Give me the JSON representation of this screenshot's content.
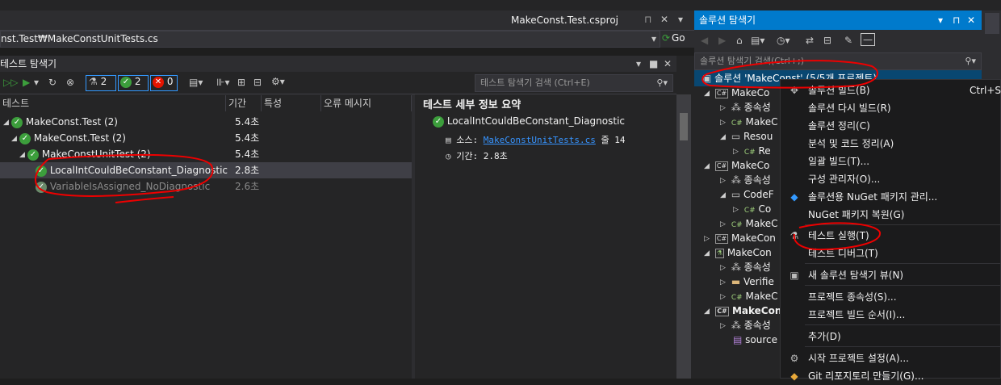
{
  "editor": {
    "doc_tab_title": "MakeConst.Test.csproj",
    "doc_tab_close": "✕",
    "nav_path": "nst.Test₩MakeConstUnitTests.cs",
    "go_label": "Go"
  },
  "test_explorer": {
    "title": "테스트 탐색기",
    "counts": {
      "total": "2",
      "passed": "2",
      "failed": "0"
    },
    "search_placeholder": "테스트 탐색기 검색 (Ctrl+E)",
    "columns": [
      "테스트",
      "기간",
      "특성",
      "오류 메시지"
    ],
    "rows": [
      {
        "name": "MakeConst.Test (2)",
        "duration": "5.4초"
      },
      {
        "name": "MakeConst.Test (2)",
        "duration": "5.4초"
      },
      {
        "name": "MakeConstUnitTest (2)",
        "duration": "5.4초"
      },
      {
        "name": "LocalIntCouldBeConstant_Diagnostic",
        "duration": "2.8초"
      },
      {
        "name": "VariableIsAssigned_NoDiagnostic",
        "duration": "2.6초"
      }
    ],
    "detail": {
      "title": "테스트 세부 정보 요약",
      "test_name": "LocalIntCouldBeConstant_Diagnostic",
      "source_label": "소스:",
      "source_file": "MakeConstUnitTests.cs",
      "line_label": "줄",
      "line_number": "14",
      "duration_label": "기간:",
      "duration_value": "2.8초"
    }
  },
  "solution_explorer": {
    "title": "솔루션 탐색기",
    "search_placeholder": "솔루션 탐색기 검색(Ctrl+;)",
    "solution_label": "솔루션 'MakeConst' (5/5개 프로젝트)",
    "tree": [
      "MakeCo",
      "종속성",
      "MakeC",
      "Resou",
      "Re",
      "MakeCo",
      "종속성",
      "CodeF",
      "Co",
      "MakeC",
      "MakeCon",
      "MakeCon",
      "종속성",
      "Verifie",
      "MakeC",
      "MakeCons",
      "종속성",
      "source"
    ]
  },
  "context_menu": {
    "items": [
      {
        "label": "솔루션 빌드(B)",
        "shortcut": "Ctrl+Sh"
      },
      {
        "label": "솔루션 다시 빌드(R)"
      },
      {
        "label": "솔루션 정리(C)"
      },
      {
        "label": "분석 및 코드 정리(A)"
      },
      {
        "label": "일괄 빌드(T)..."
      },
      {
        "label": "구성 관리자(O)..."
      },
      {
        "label": "솔루션용 NuGet 패키지 관리..."
      },
      {
        "label": "NuGet 패키지 복원(G)"
      },
      {
        "label": "테스트 실행(T)"
      },
      {
        "label": "테스트 디버그(T)"
      },
      {
        "label": "새 솔루션 탐색기 뷰(N)"
      },
      {
        "label": "프로젝트 종속성(S)..."
      },
      {
        "label": "프로젝트 빌드 순서(I)..."
      },
      {
        "label": "추가(D)"
      },
      {
        "label": "시작 프로젝트 설정(A)..."
      },
      {
        "label": "Git 리포지토리 만들기(G)..."
      }
    ]
  },
  "colors": {
    "accent": "#007acc",
    "pass": "#3c9e3c",
    "fail": "#e51400",
    "annotation": "#ee0000"
  }
}
